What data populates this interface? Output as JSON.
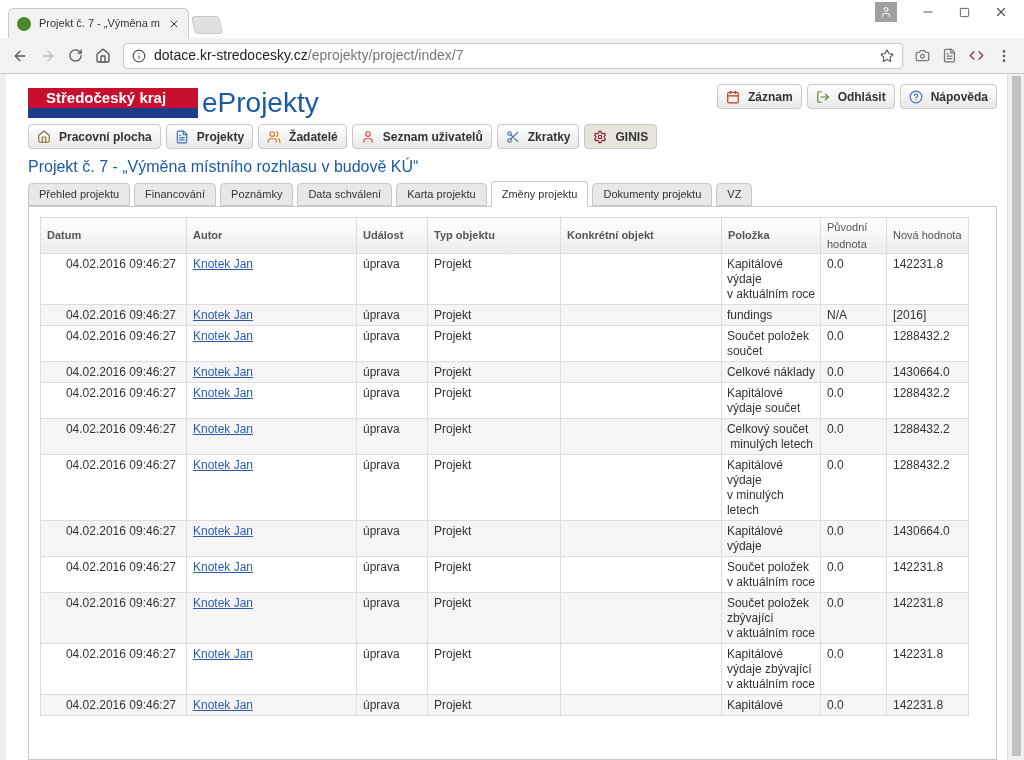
{
  "browser": {
    "tab_title": "Projekt č. 7 - „Výměna m",
    "url_host": "dotace.kr-stredocesky.cz",
    "url_path": "/eprojekty/project/index/7"
  },
  "logo": {
    "region": "Středočeský kraj",
    "app": "eProjekty"
  },
  "top_buttons": [
    {
      "label": "Záznam"
    },
    {
      "label": "Odhlásit"
    },
    {
      "label": "Nápověda"
    }
  ],
  "nav_buttons": [
    {
      "label": "Pracovní plocha",
      "selected": false
    },
    {
      "label": "Projekty",
      "selected": false
    },
    {
      "label": "Žadatelé",
      "selected": false
    },
    {
      "label": "Seznam uživatelů",
      "selected": false
    },
    {
      "label": "Zkratky",
      "selected": false
    },
    {
      "label": "GINIS",
      "selected": true
    }
  ],
  "page_title": "Projekt č. 7 - „Výměna místního rozhlasu v budově KÚ“",
  "tabs": [
    {
      "label": "Přehled projektu",
      "selected": false
    },
    {
      "label": "Financování",
      "selected": false
    },
    {
      "label": "Poznámky",
      "selected": false
    },
    {
      "label": "Data schválení",
      "selected": false
    },
    {
      "label": "Karta projektu",
      "selected": false
    },
    {
      "label": "Změny projektu",
      "selected": true
    },
    {
      "label": "Dokumenty projektu",
      "selected": false
    },
    {
      "label": "VZ",
      "selected": false
    }
  ],
  "table": {
    "columns": [
      "Datum",
      "Autor",
      "Událost",
      "Typ objektu",
      "Konkrétní objekt",
      "Položka",
      "Původní hodnota",
      "Nová hodnota"
    ],
    "rows": [
      {
        "date": "04.02.2016 09:46:27",
        "author": "Knotek Jan",
        "event": "úprava",
        "type": "Projekt",
        "item": "Kapitálové\nvýdaje\nv aktuálním roce",
        "old": "0.0",
        "new": "142231.8"
      },
      {
        "date": "04.02.2016 09:46:27",
        "author": "Knotek Jan",
        "event": "úprava",
        "type": "Projekt",
        "item": "fundings",
        "old": "N/A",
        "new": "[2016]"
      },
      {
        "date": "04.02.2016 09:46:27",
        "author": "Knotek Jan",
        "event": "úprava",
        "type": "Projekt",
        "item": "Součet položek\nsoučet",
        "old": "0.0",
        "new": "1288432.2"
      },
      {
        "date": "04.02.2016 09:46:27",
        "author": "Knotek Jan",
        "event": "úprava",
        "type": "Projekt",
        "item": "Celkové náklady",
        "old": "0.0",
        "new": "1430664.0"
      },
      {
        "date": "04.02.2016 09:46:27",
        "author": "Knotek Jan",
        "event": "úprava",
        "type": "Projekt",
        "item": "Kapitálové\nvýdaje součet",
        "old": "0.0",
        "new": "1288432.2"
      },
      {
        "date": "04.02.2016 09:46:27",
        "author": "Knotek Jan",
        "event": "úprava",
        "type": "Projekt",
        "item": "Celkový součet\n minulých letech",
        "old": "0.0",
        "new": "1288432.2"
      },
      {
        "date": "04.02.2016 09:46:27",
        "author": "Knotek Jan",
        "event": "úprava",
        "type": "Projekt",
        "item": "Kapitálové\nvýdaje\nv minulých\nletech",
        "old": "0.0",
        "new": "1288432.2"
      },
      {
        "date": "04.02.2016 09:46:27",
        "author": "Knotek Jan",
        "event": "úprava",
        "type": "Projekt",
        "item": "Kapitálové\nvýdaje",
        "old": "0.0",
        "new": "1430664.0"
      },
      {
        "date": "04.02.2016 09:46:27",
        "author": "Knotek Jan",
        "event": "úprava",
        "type": "Projekt",
        "item": "Součet položek\nv aktuálním roce",
        "old": "0.0",
        "new": "142231.8"
      },
      {
        "date": "04.02.2016 09:46:27",
        "author": "Knotek Jan",
        "event": "úprava",
        "type": "Projekt",
        "item": "Součet položek\nzbývající\nv aktuálním roce",
        "old": "0.0",
        "new": "142231.8"
      },
      {
        "date": "04.02.2016 09:46:27",
        "author": "Knotek Jan",
        "event": "úprava",
        "type": "Projekt",
        "item": "Kapitálové\nvýdaje zbývající\nv aktuálním roce",
        "old": "0.0",
        "new": "142231.8"
      },
      {
        "date": "04.02.2016 09:46:27",
        "author": "Knotek Jan",
        "event": "úprava",
        "type": "Projekt",
        "item": "Kapitálové",
        "old": "0.0",
        "new": "142231.8"
      }
    ]
  }
}
